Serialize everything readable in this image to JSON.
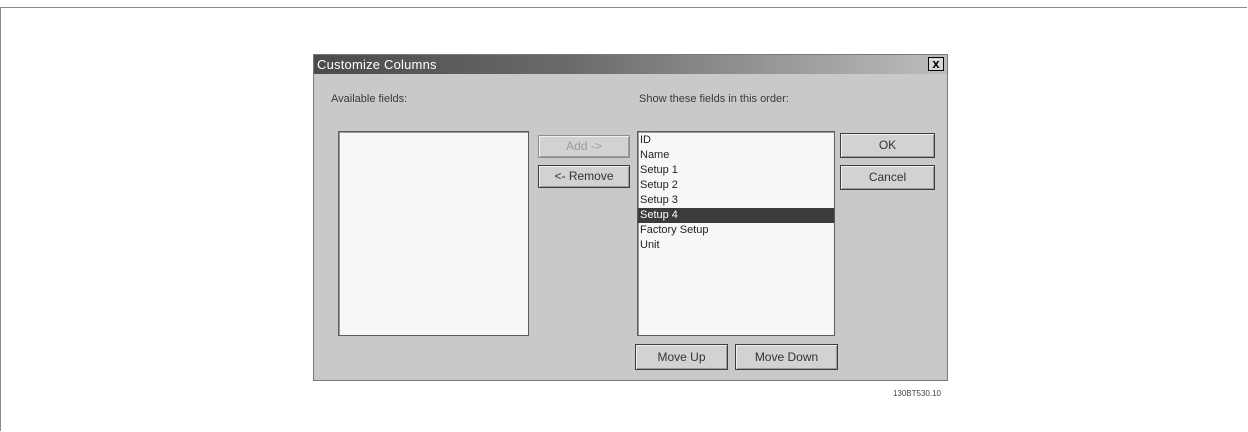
{
  "dialog": {
    "title": "Customize Columns",
    "close_label": "x",
    "available_label": "Available fields:",
    "show_label": "Show these fields in this order:",
    "available_items": [],
    "shown_items": [
      "ID",
      "Name",
      "Setup 1",
      "Setup 2",
      "Setup 3",
      "Setup 4",
      "Factory Setup",
      "Unit"
    ],
    "selected_item": "Setup 4",
    "buttons": {
      "add": "Add ->",
      "remove": "<- Remove",
      "ok": "OK",
      "cancel": "Cancel",
      "move_up": "Move Up",
      "move_down": "Move Down"
    }
  },
  "figure_ref": "130BT530.10"
}
